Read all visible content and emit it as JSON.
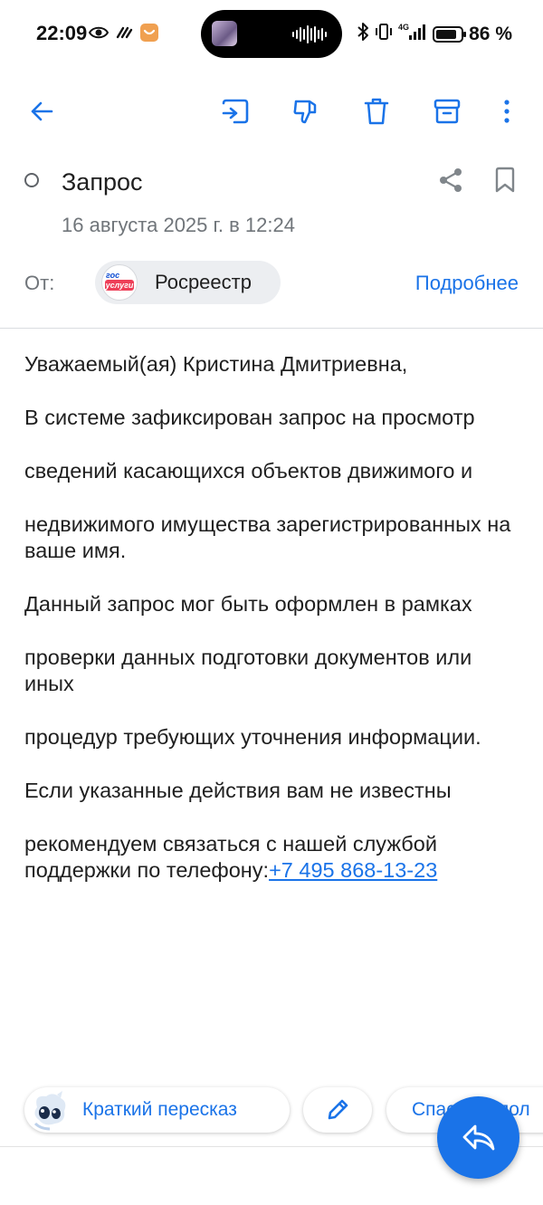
{
  "status_bar": {
    "time": "22:09",
    "battery": "86 %",
    "battery_level": 0.86,
    "icons_left": [
      "eye-icon",
      "vpn-icon",
      "app-notification-icon"
    ],
    "icons_right": [
      "bluetooth-icon",
      "vibrate-icon",
      "signal-4g-icon",
      "battery-icon"
    ]
  },
  "toolbar": {
    "back": "arrow-left-icon",
    "move": "move-to-icon",
    "spam": "spam-thumb-down-icon",
    "delete": "trash-icon",
    "archive": "archive-icon",
    "more": "more-vertical-icon"
  },
  "message": {
    "subject": "Запрос",
    "date": "16 августа 2025 г. в 12:24",
    "from_label": "От:",
    "sender_name": "Росреестр",
    "sender_logo_top": "гос",
    "sender_logo_bottom": "услуги",
    "details_link": "Подробнее",
    "body": [
      "Уважаемый(ая) Кристина Дмитриевна,",
      "В системе зафиксирован запрос на просмотр",
      "сведений касающихся объектов движимого и",
      "недвижимого имущества зарегистрированных на ваше имя.",
      "Данный запрос мог быть оформлен в рамках",
      "проверки данных подготовки документов или иных",
      "процедур требующих уточнения информации.",
      "Если указанные действия вам не известны"
    ],
    "last_paragraph_text": "рекомендуем связаться с нашей службой поддержки по телефону:",
    "phone": "+7 495 868-13-23"
  },
  "bottom": {
    "summary_label": "Краткий пересказ",
    "thanks_label": "Спасибо, пол",
    "fab_icon": "reply-icon"
  },
  "colors": {
    "accent": "#1a73e8",
    "text": "#1f1f1f",
    "secondary": "#70757a"
  }
}
